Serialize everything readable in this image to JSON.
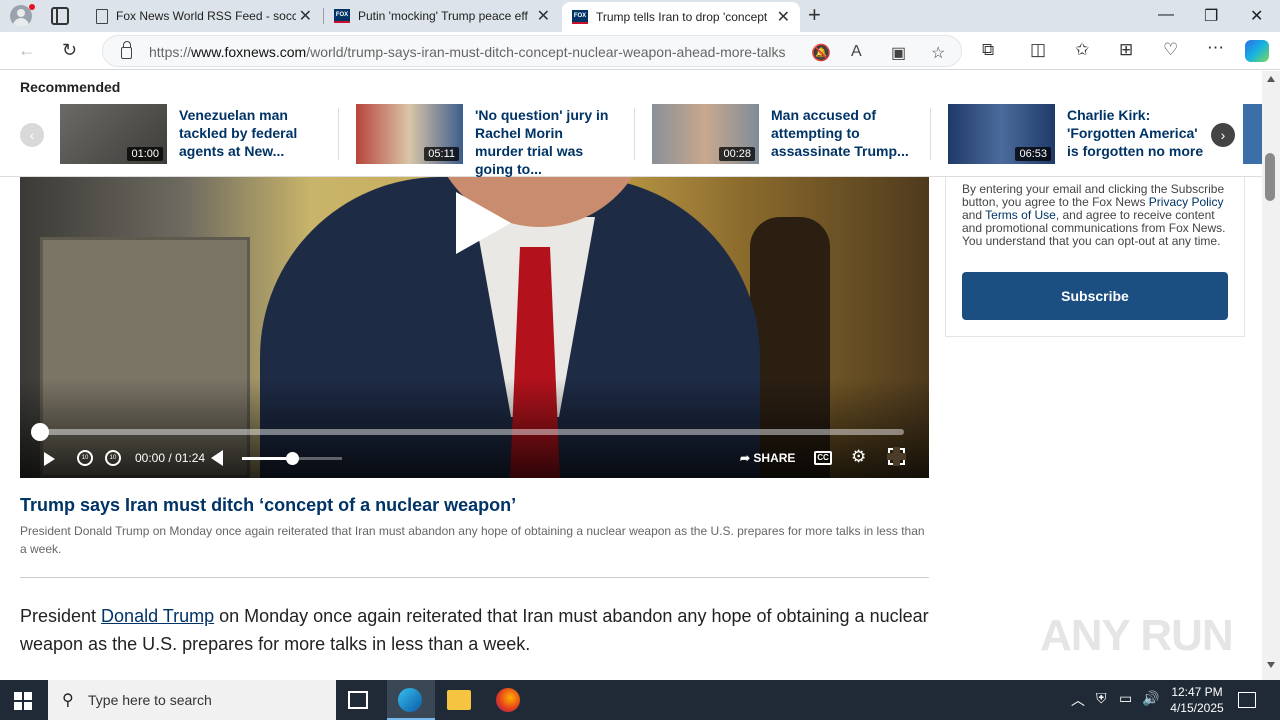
{
  "browser": {
    "tabs": [
      {
        "title": "Fox News World RSS Feed - socc",
        "active": false
      },
      {
        "title": "Putin 'mocking' Trump peace eff",
        "active": false
      },
      {
        "title": "Trump tells Iran to drop 'concept",
        "active": true
      }
    ],
    "url_prefix": "https://",
    "url_domain": "www.foxnews.com",
    "url_path": "/world/trump-says-iran-must-ditch-concept-nuclear-weapon-ahead-more-talks"
  },
  "recommended": {
    "heading": "Recommended",
    "items": [
      {
        "title": "Venezuelan man tackled by federal agents at New...",
        "duration": "01:00"
      },
      {
        "title": "'No question' jury in Rachel Morin murder trial was going to...",
        "duration": "05:11"
      },
      {
        "title": "Man accused of attempting to assassinate Trump...",
        "duration": "00:28"
      },
      {
        "title": "Charlie Kirk: 'Forgotten America' is forgotten no more",
        "duration": "06:53"
      }
    ]
  },
  "video": {
    "current_time": "00:00",
    "separator": "/",
    "duration": "01:24",
    "share_label": "SHARE",
    "cc_label": "CC",
    "progress_fraction": 0,
    "volume_fraction": 0.5
  },
  "article": {
    "video_title": "Trump says Iran must ditch ‘concept of a nuclear weapon’",
    "video_description": "President Donald Trump on Monday once again reiterated that Iran must abandon any hope of obtaining a nuclear weapon as the U.S. prepares for more talks in less than a week.",
    "body_prefix": "President ",
    "body_link": "Donald Trump",
    "body_suffix": " on Monday once again reiterated that Iran must abandon any hope of obtaining a nuclear weapon as the U.S. prepares for more talks in less than a week."
  },
  "sidebar": {
    "consent_before": "By entering your email and clicking the Subscribe button, you agree to the Fox News ",
    "privacy_link": "Privacy Policy",
    "and_text": " and ",
    "terms_link": "Terms of Use",
    "consent_after": ", and agree to receive content and promotional communications from Fox News. You understand that you can opt-out at any time.",
    "subscribe_label": "Subscribe"
  },
  "watermark": "ANY RUN",
  "taskbar": {
    "search_placeholder": "Type here to search",
    "time": "12:47 PM",
    "date": "4/15/2025"
  },
  "colors": {
    "fox_navy": "#003366",
    "subscribe_blue": "#1b4f82",
    "taskbar": "#1f2a36"
  }
}
